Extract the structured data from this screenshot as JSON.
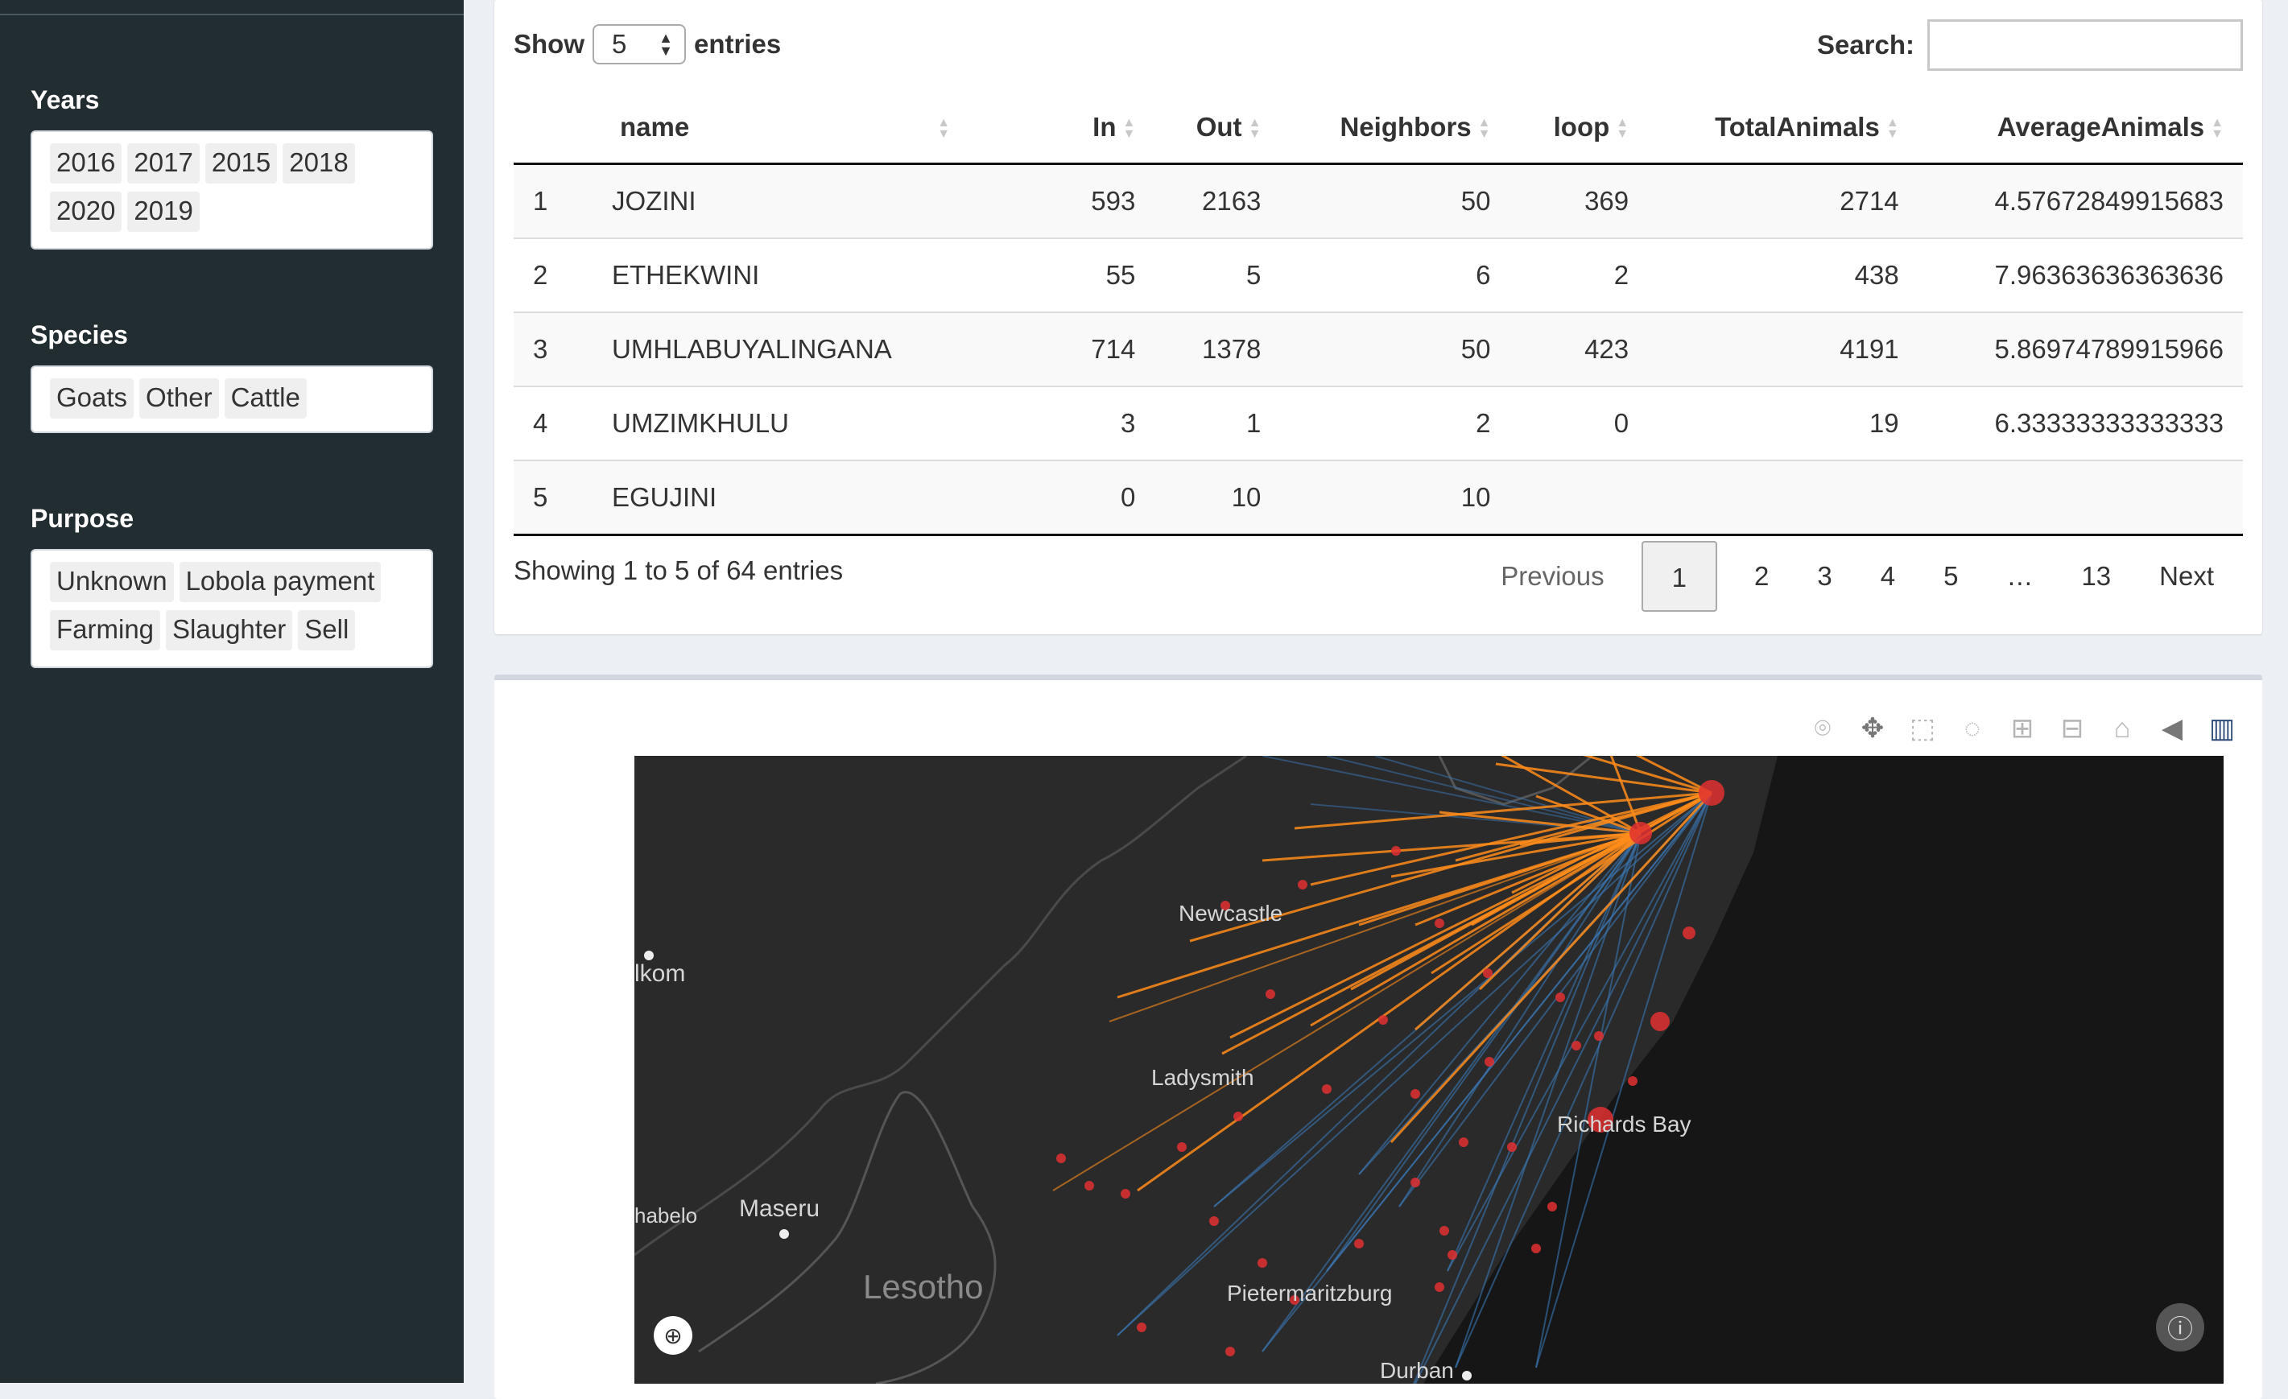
{
  "sidebar": {
    "years": {
      "label": "Years",
      "chips": [
        "2016",
        "2017",
        "2015",
        "2018",
        "2020",
        "2019"
      ]
    },
    "species": {
      "label": "Species",
      "chips": [
        "Goats",
        "Other",
        "Cattle"
      ]
    },
    "purpose": {
      "label": "Purpose",
      "chips": [
        "Unknown",
        "Lobola payment",
        "Farming",
        "Slaughter",
        "Sell"
      ]
    }
  },
  "table_box": {
    "show_label": "Show",
    "entries_label": "entries",
    "page_length": "5",
    "search_label": "Search:",
    "search_value": "",
    "columns": [
      "",
      "name",
      "In",
      "Out",
      "Neighbors",
      "loop",
      "TotalAnimals",
      "AverageAnimals"
    ],
    "rows": [
      [
        "1",
        "JOZINI",
        "593",
        "2163",
        "50",
        "369",
        "2714",
        "4.57672849915683"
      ],
      [
        "2",
        "ETHEKWINI",
        "55",
        "5",
        "6",
        "2",
        "438",
        "7.96363636363636"
      ],
      [
        "3",
        "UMHLABUYALINGANA",
        "714",
        "1378",
        "50",
        "423",
        "4191",
        "5.86974789915966"
      ],
      [
        "4",
        "UMZIMKHULU",
        "3",
        "1",
        "2",
        "0",
        "19",
        "6.33333333333333"
      ],
      [
        "5",
        "EGUJINI",
        "0",
        "10",
        "10",
        "",
        "",
        ""
      ]
    ],
    "info": "Showing 1 to 5 of 64 entries",
    "pager": {
      "previous": "Previous",
      "pages": [
        "1",
        "2",
        "3",
        "4",
        "5",
        "…",
        "13"
      ],
      "current": "1",
      "next": "Next"
    }
  },
  "map": {
    "labels": {
      "newcastle": "Newcastle",
      "welkom": "lkom",
      "ladysmith": "Ladysmith",
      "richards_bay": "Richards Bay",
      "thabelo": "habelo",
      "maseru": "Maseru",
      "lesotho": "Lesotho",
      "pietermaritzburg": "Pietermaritzburg",
      "durban": "Durban"
    },
    "modebar_icons": [
      "camera-icon",
      "pan-icon",
      "box-select-icon",
      "lasso-icon",
      "zoom-in-icon",
      "zoom-out-icon",
      "home-icon",
      "hover-icon",
      "plotly-logo-icon"
    ],
    "colors": {
      "flow_high": "#ff8c1a",
      "flow_low": "#3a78b5",
      "node": "#e03030",
      "ocean": "#161616",
      "land": "#2a2a2a"
    }
  }
}
